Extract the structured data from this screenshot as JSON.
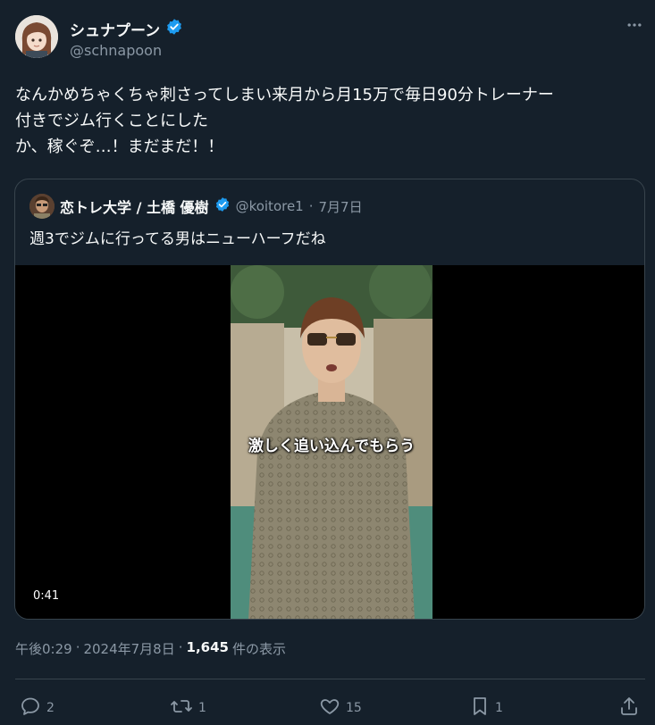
{
  "author": {
    "display_name": "シュナプーン",
    "handle": "@schnapoon",
    "verified": true
  },
  "more_icon": "more-horizontal-icon",
  "tweet_text": "なんかめちゃくちゃ刺さってしまい来月から月15万で毎日90分トレーナー\n付きでジム行くことにした\nか、稼ぐぞ…！まだまだ！！",
  "quote": {
    "display_name": "恋トレ大学 / 土橋 優樹",
    "handle": "@koitore1",
    "date": "7月7日",
    "separator": "·",
    "text": "週3でジムに行ってる男はニューハーフだね",
    "video": {
      "subtitle": "激しく追い込んでもらう",
      "duration": "0:41"
    }
  },
  "meta": {
    "time": "午後0:29",
    "separator": "·",
    "date": "2024年7月8日",
    "views_count": "1,645",
    "views_label": "件の表示"
  },
  "actions": {
    "reply": {
      "icon": "reply-icon",
      "count": "2"
    },
    "retweet": {
      "icon": "retweet-icon",
      "count": "1"
    },
    "like": {
      "icon": "heart-icon",
      "count": "15"
    },
    "bookmark": {
      "icon": "bookmark-icon",
      "count": "1"
    },
    "share": {
      "icon": "share-icon"
    }
  },
  "colors": {
    "background": "#15202b",
    "text": "#f7f9f9",
    "muted": "#8b98a5",
    "border": "#38444d",
    "verified": "#1d9bf0"
  }
}
